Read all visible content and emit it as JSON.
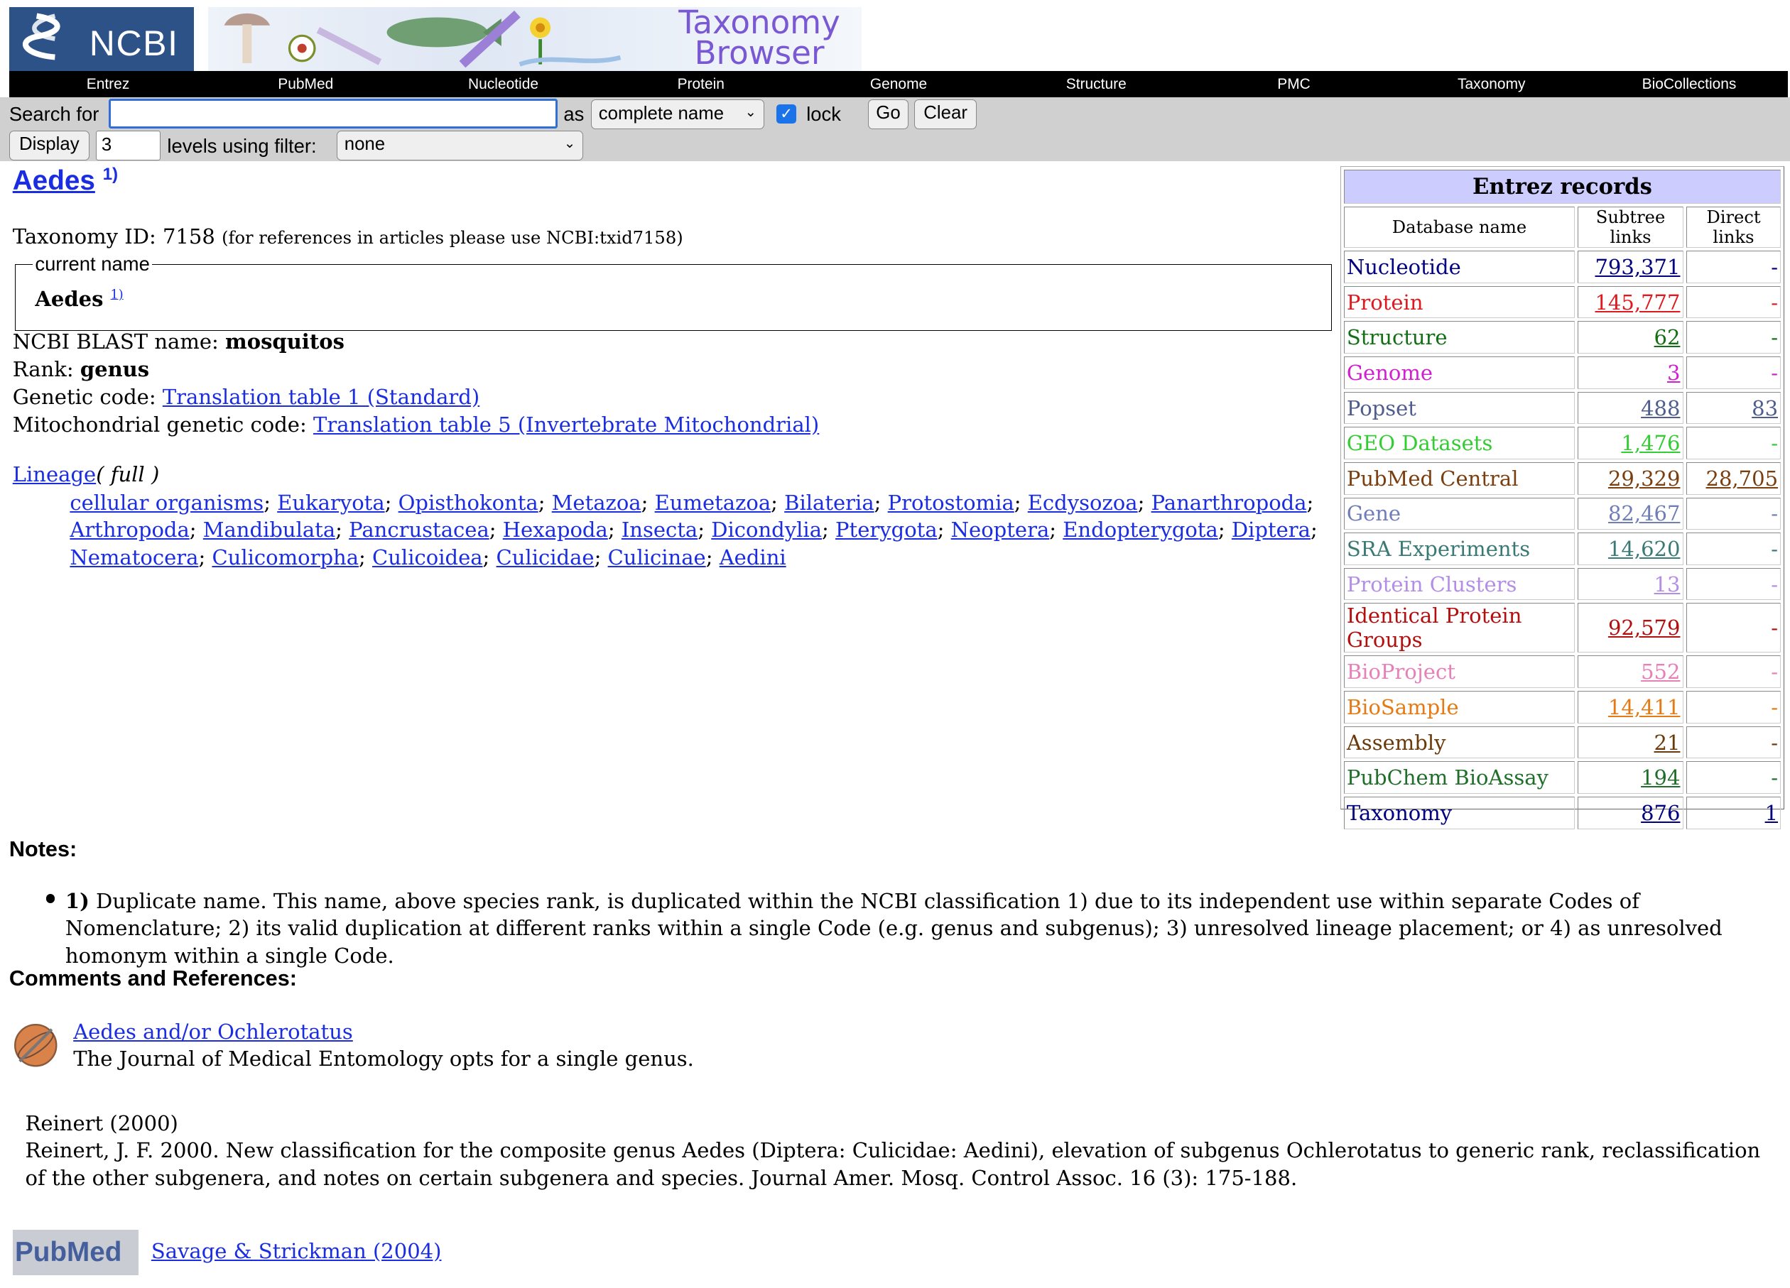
{
  "header": {
    "logo_text": "NCBI",
    "browser_title_line1": "Taxonomy",
    "browser_title_line2": "Browser"
  },
  "nav": [
    "Entrez",
    "PubMed",
    "Nucleotide",
    "Protein",
    "Genome",
    "Structure",
    "PMC",
    "Taxonomy",
    "BioCollections"
  ],
  "search": {
    "search_for_label": "Search for",
    "search_value": "",
    "as_label": "as",
    "as_selected": "complete name",
    "lock_label": "lock",
    "lock_checked": true,
    "go_label": "Go",
    "clear_label": "Clear",
    "display_label": "Display",
    "levels_value": "3",
    "levels_label": "levels using filter:",
    "filter_selected": "none"
  },
  "taxon": {
    "name": "Aedes",
    "name_sup": "1)",
    "taxonomy_id_label": "Taxonomy ID: 7158",
    "taxonomy_id_note": "(for references in articles please use NCBI:txid7158)",
    "current_name_legend": "current name",
    "current_name": "Aedes",
    "current_name_sup": "1)",
    "blast_label": "NCBI BLAST name: ",
    "blast_value": "mosquitos",
    "rank_label": "Rank: ",
    "rank_value": "genus",
    "genetic_code_label": "Genetic code: ",
    "genetic_code_link": "Translation table 1 (Standard)",
    "mito_code_label": "Mitochondrial genetic code: ",
    "mito_code_link": "Translation table 5 (Invertebrate Mitochondrial)"
  },
  "lineage": {
    "label": "Lineage",
    "full_label": "( full )",
    "items": [
      "cellular organisms",
      "Eukaryota",
      "Opisthokonta",
      "Metazoa",
      "Eumetazoa",
      "Bilateria",
      "Protostomia",
      "Ecdysozoa",
      "Panarthropoda",
      "Arthropoda",
      "Mandibulata",
      "Pancrustacea",
      "Hexapoda",
      "Insecta",
      "Dicondylia",
      "Pterygota",
      "Neoptera",
      "Endopterygota",
      "Diptera",
      "Nematocera",
      "Culicomorpha",
      "Culicoidea",
      "Culicidae",
      "Culicinae",
      "Aedini"
    ]
  },
  "entrez": {
    "title": "Entrez records",
    "col_db": "Database name",
    "col_subtree": "Subtree links",
    "col_direct": "Direct links",
    "rows": [
      {
        "name": "Nucleotide",
        "subtree": "793,371",
        "direct": "-",
        "color": "#000080",
        "direct_link": false
      },
      {
        "name": "Protein",
        "subtree": "145,777",
        "direct": "-",
        "color": "#e0191f",
        "direct_link": false
      },
      {
        "name": "Structure",
        "subtree": "62",
        "direct": "-",
        "color": "#136f13",
        "direct_link": false
      },
      {
        "name": "Genome",
        "subtree": "3",
        "direct": "-",
        "color": "#d020d0",
        "direct_link": false
      },
      {
        "name": "Popset",
        "subtree": "488",
        "direct": "83",
        "color": "#4e5d8e",
        "direct_link": true
      },
      {
        "name": "GEO Datasets",
        "subtree": "1,476",
        "direct": "-",
        "color": "#33cc33",
        "direct_link": false
      },
      {
        "name": "PubMed Central",
        "subtree": "29,329",
        "direct": "28,705",
        "color": "#7a3e0f",
        "direct_link": true
      },
      {
        "name": "Gene",
        "subtree": "82,467",
        "direct": "-",
        "color": "#6f7eb8",
        "direct_link": false
      },
      {
        "name": "SRA Experiments",
        "subtree": "14,620",
        "direct": "-",
        "color": "#3a7a74",
        "direct_link": false
      },
      {
        "name": "Protein Clusters",
        "subtree": "13",
        "direct": "-",
        "color": "#b38ee6",
        "direct_link": false
      },
      {
        "name": "Identical Protein Groups",
        "subtree": "92,579",
        "direct": "-",
        "color": "#b30f0f",
        "direct_link": false
      },
      {
        "name": "BioProject",
        "subtree": "552",
        "direct": "-",
        "color": "#e880b8",
        "direct_link": false
      },
      {
        "name": "BioSample",
        "subtree": "14,411",
        "direct": "-",
        "color": "#e57a14",
        "direct_link": false
      },
      {
        "name": "Assembly",
        "subtree": "21",
        "direct": "-",
        "color": "#6b3a0a",
        "direct_link": false
      },
      {
        "name": "PubChem BioAssay",
        "subtree": "194",
        "direct": "-",
        "color": "#1f6f2a",
        "direct_link": false
      },
      {
        "name": "Taxonomy",
        "subtree": "876",
        "direct": "1",
        "color": "#000080",
        "direct_link": true
      }
    ]
  },
  "notes": {
    "heading": "Notes:",
    "item_num": "1)",
    "item_text": " Duplicate name. This name, above species rank, is duplicated within the NCBI classification 1) due to its independent use within separate Codes of Nomenclature; 2) its valid duplication at different ranks within a single Code (e.g. genus and subgenus); 3) unresolved lineage placement; or 4) as unresolved homonym within a single Code."
  },
  "comments": {
    "heading": "Comments and References:",
    "ref1_link": "Aedes and/or Ochlerotatus",
    "ref1_text": "The Journal of Medical Entomology opts for a single genus.",
    "ref2_title": "Reinert (2000)",
    "ref2_text": "Reinert, J. F. 2000. New classification for the composite genus Aedes (Diptera: Culicidae: Aedini), elevation of subgenus Ochlerotatus to generic rank, reclassification of the other subgenera, and notes on certain subgenera and species. Journal Amer. Mosq. Control Assoc. 16 (3): 175-188.",
    "pubmed_logo_text": "PubMed",
    "ref3_link": "Savage & Strickman (2004)"
  }
}
